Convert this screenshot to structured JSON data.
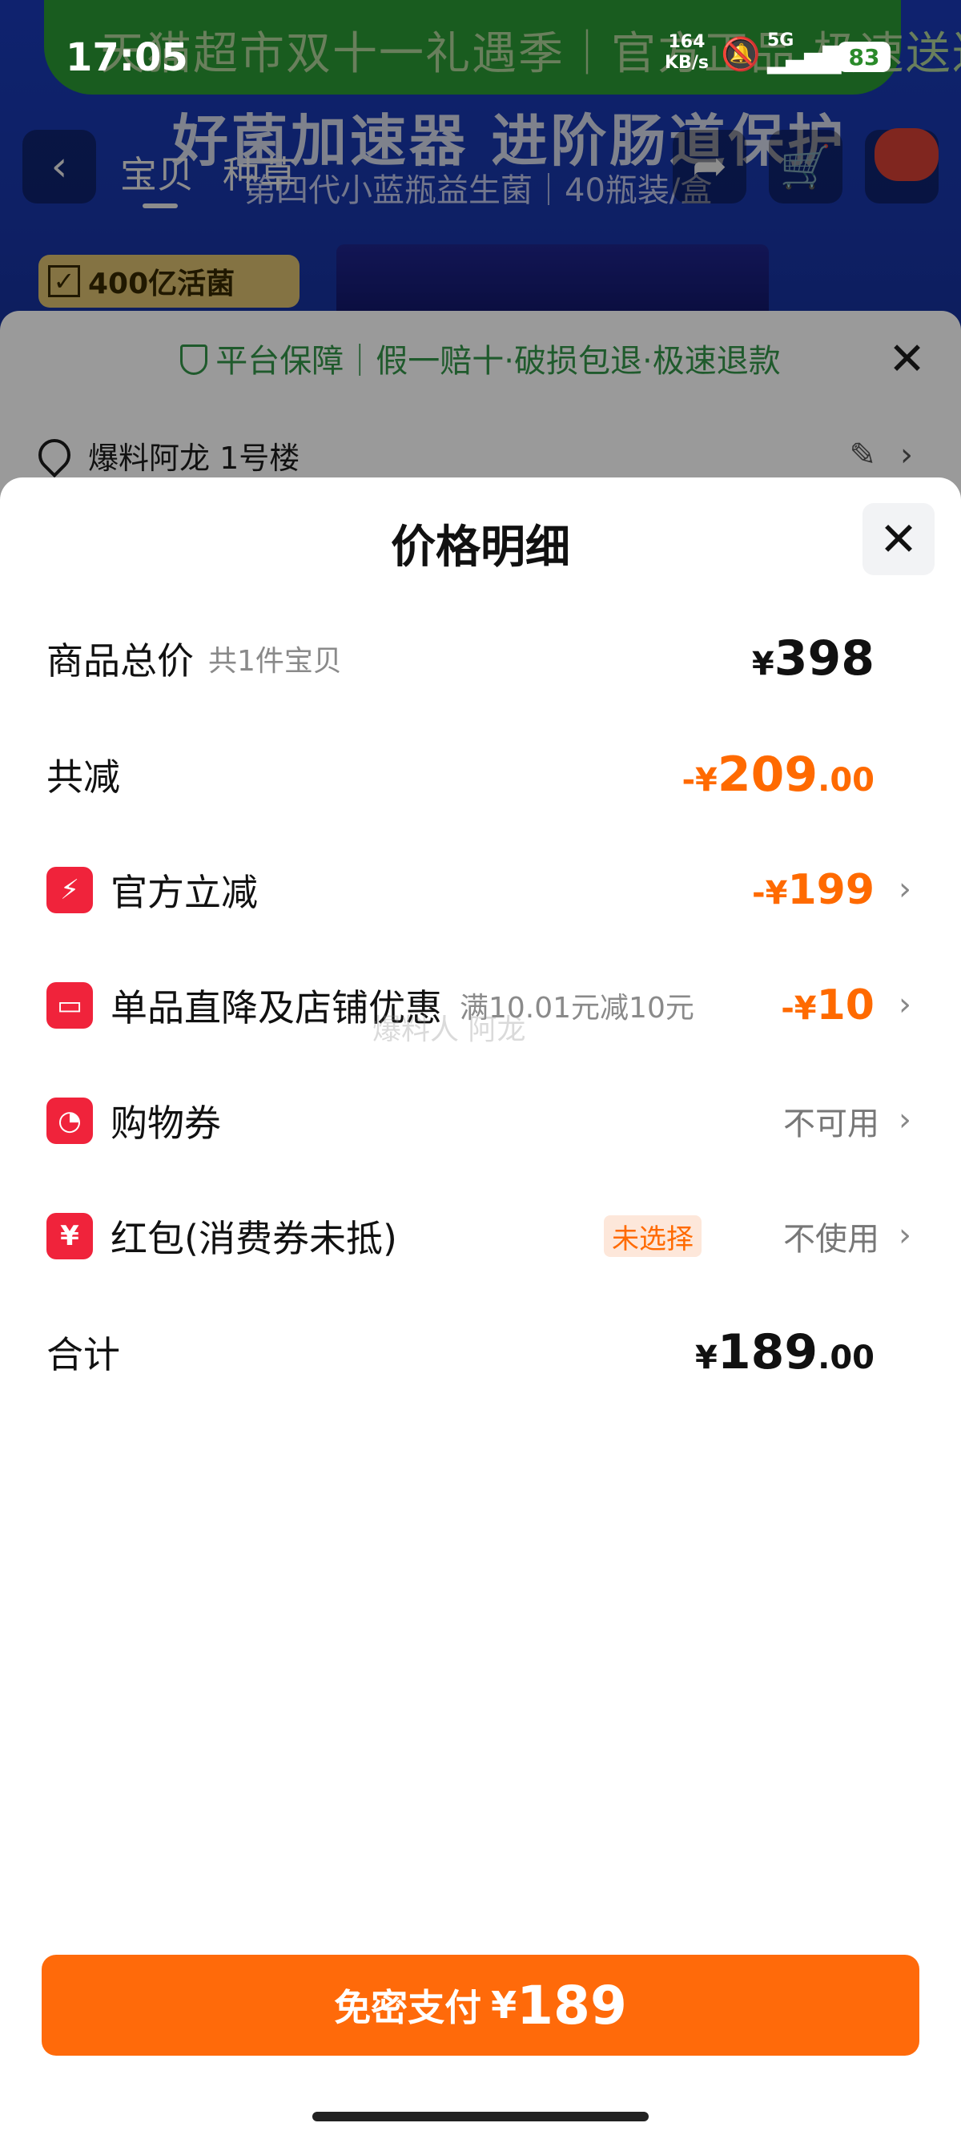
{
  "status_bar": {
    "time": "17:05",
    "net_speed_value": "164",
    "net_speed_unit": "KB/s",
    "network": "5G",
    "battery": "83"
  },
  "background_page": {
    "banner_text": "天猫超市双十一礼遇季｜官方正品 极速送达",
    "slogan": "好菌加速器 进阶肠道保护",
    "subtitle": "第四代小蓝瓶益生菌｜40瓶装/盒",
    "tabs": [
      "宝贝",
      "种草"
    ],
    "badge": "400亿活菌"
  },
  "order_sheet": {
    "guarantee": "平台保障｜假一赔十·破损包退·极速退款",
    "address": "爆料阿龙 1号楼"
  },
  "price_detail": {
    "title": "价格明细",
    "rows": [
      {
        "label": "商品总价",
        "sub": "共1件宝贝",
        "currency": "¥",
        "amount_int": "398",
        "amount_dec": ""
      },
      {
        "label": "共减",
        "prefix": "-¥",
        "amount_int": "209",
        "amount_dec": ".00"
      },
      {
        "label": "官方立减",
        "prefix": "-¥",
        "amount_int": "199"
      },
      {
        "label": "单品直降及店铺优惠",
        "sub": "满10.01元减10元",
        "prefix": "-¥",
        "amount_int": "10"
      },
      {
        "label": "购物券",
        "status": "不可用"
      },
      {
        "label": "红包(消费券未抵)",
        "tag": "未选择",
        "status": "不使用"
      },
      {
        "label": "合计",
        "currency": "¥",
        "amount_int": "189",
        "amount_dec": ".00"
      }
    ],
    "watermark": "爆料人 阿龙"
  },
  "pay_button": {
    "label": "免密支付",
    "currency": "¥",
    "amount": "189"
  },
  "colors": {
    "accent_orange": "#ff6a00",
    "icon_red": "#f0233b",
    "button_orange": "#ff6a0a"
  }
}
